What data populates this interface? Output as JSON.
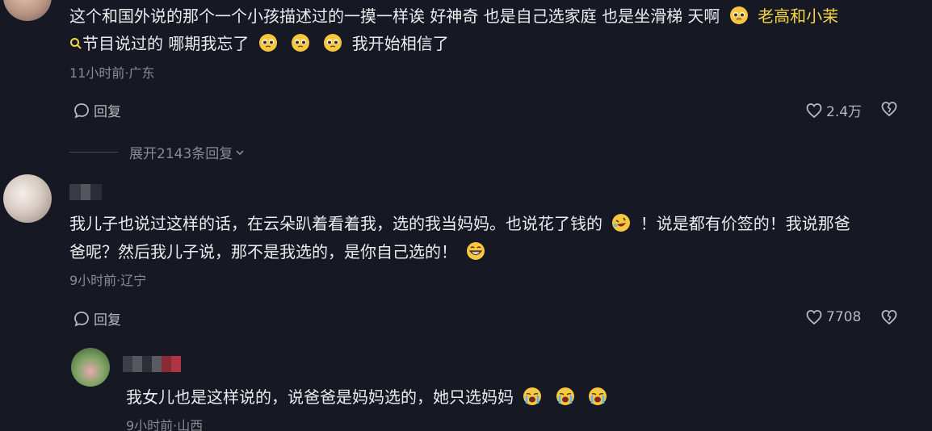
{
  "comment1": {
    "line1_text": "这个和国外说的那个一个小孩描述过的一摸一样诶 好神奇 也是自己选家庭 也是坐滑梯 天啊",
    "mention": "老高和小茉",
    "line2_text": "节目说过的 哪期我忘了",
    "line2_tail": "我开始相信了",
    "meta": "11小时前·广东",
    "reply_label": "回复",
    "like_count": "2.4万",
    "expand_label": "展开2143条回复"
  },
  "comment2": {
    "line1_text": "我儿子也说过这样的话，在云朵趴着看着我，选的我当妈妈。也说花了钱的",
    "line1_tail": "！说是都有价签的！我说那爸",
    "line2_text": "爸呢？然后我儿子说，那不是我选的，是你自己选的！",
    "meta": "9小时前·辽宁",
    "reply_label": "回复",
    "like_count": "7708"
  },
  "reply1": {
    "text": "我女儿也是这样说的，说爸爸是妈妈选的，她只选妈妈",
    "meta": "9小时前·山西"
  },
  "icons": {
    "reply": "comment-bubble-icon",
    "like": "heart-icon",
    "dislike": "broken-heart-icon",
    "search": "search-icon",
    "expand": "chevron-down-icon"
  },
  "colors": {
    "background": "#161823",
    "mention": "#f5d547",
    "meta": "#8a8b91"
  }
}
